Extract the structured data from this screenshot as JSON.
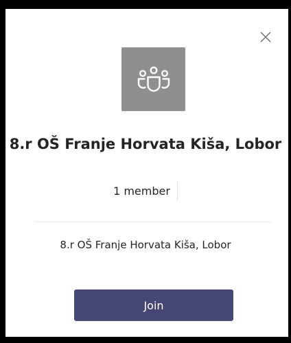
{
  "dialog": {
    "close_icon": "close-icon",
    "team_icon": "people-team-icon",
    "team_tile_color": "#8f8f8f",
    "team_name": "8.r OŠ Franje Horvata Kiša, Lobor",
    "member_count_label": "1 member",
    "description": "8.r OŠ Franje Horvata Kiša, Lobor",
    "join_label": "Join",
    "accent_color": "#464775"
  }
}
